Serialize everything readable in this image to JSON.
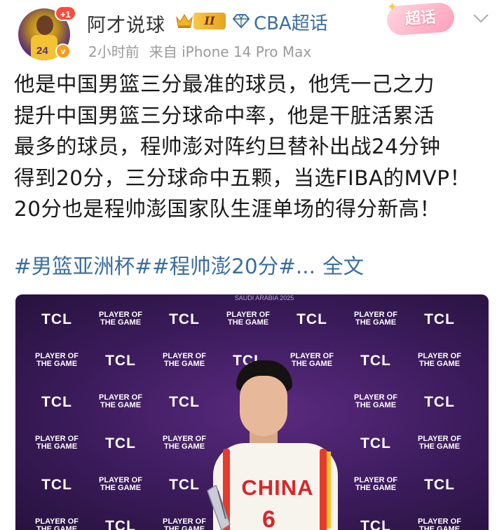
{
  "user": {
    "name": "阿才说球",
    "plus_badge": "+1",
    "verified_mark": "v",
    "level_roman": "II",
    "super_topic": "CBA超话",
    "chaohua_button": "超话"
  },
  "meta": {
    "time": "2小时前",
    "source": "来自 iPhone 14 Pro Max"
  },
  "post": {
    "lines": [
      "他是中国男篮三分最准的球员，他凭一己之力",
      "提升中国男篮三分球命中率，他是干脏活累活",
      "最多的球员，程帅澎对阵约旦替补出战24分钟",
      "得到20分，三分球命中五颗，当选FIBA的MVP！",
      "20分也是程帅澎国家队生涯单场的得分新高！"
    ],
    "tag1": "#男篮亚洲杯#",
    "tag2": "#程帅澎20分#",
    "ellipsis": "...",
    "full_text": "全文"
  },
  "photo": {
    "backdrop_brand": "TCL",
    "backdrop_award_line1": "PLAYER OF",
    "backdrop_award_line2": "THE GAME",
    "top_strip": "SAUDI ARABIA 2025",
    "jersey_text": "CHINA",
    "jersey_number": "6"
  },
  "colors": {
    "link_blue": "#3b6e9e",
    "meta_gray": "#9a9a9a",
    "backdrop_purple": "#3b1b5b",
    "jersey_red": "#d8262b"
  },
  "icons": {
    "crown": "crown-icon",
    "diamond": "diamond-icon",
    "chevron": "chevron-down-icon",
    "star": "star-icon"
  }
}
